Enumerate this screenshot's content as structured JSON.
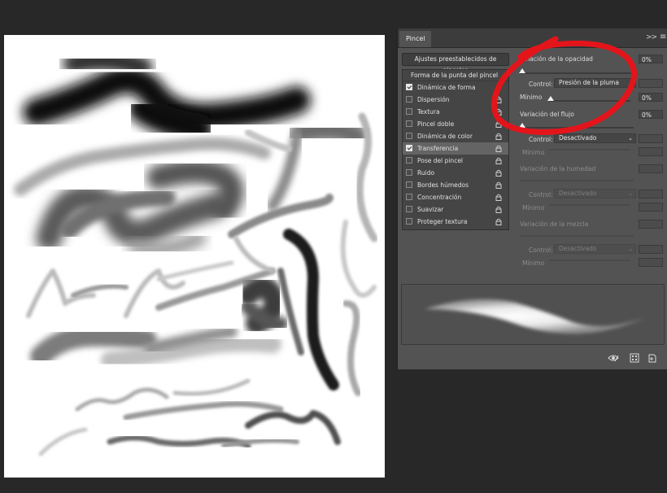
{
  "panel": {
    "tab_label": "Pincel",
    "collapse_label": ">>",
    "presets_button": "Ajustes preestablecidos de pinceles",
    "list_header": "Forma de la punta del pincel",
    "items": [
      {
        "label": "Dinámica de forma",
        "checked": true
      },
      {
        "label": "Dispersión",
        "checked": false
      },
      {
        "label": "Textura",
        "checked": false
      },
      {
        "label": "Pincel doble",
        "checked": false
      },
      {
        "label": "Dinámica de color",
        "checked": false
      },
      {
        "label": "Transferencia",
        "checked": true,
        "active": true
      },
      {
        "label": "Pose del pincel",
        "checked": false
      },
      {
        "label": "Ruido",
        "checked": false
      },
      {
        "label": "Bordes húmedos",
        "checked": false
      },
      {
        "label": "Concentración",
        "checked": false
      },
      {
        "label": "Suavizar",
        "checked": false
      },
      {
        "label": "Proteger textura",
        "checked": false
      }
    ]
  },
  "settings": {
    "opacity_label": "Variación de la opacidad",
    "opacity_value": "0%",
    "control_label": "Control:",
    "control_value": "Presión de la pluma",
    "min_label": "Mínimo",
    "min_value": "0%",
    "flow_label": "Variación del flujo",
    "flow_value": "0%",
    "flow_control_label": "Control:",
    "flow_control_value": "Desactivado",
    "flow_min_label": "Mínimo",
    "wet_label": "Variación de la humedad",
    "wet_control_label": "Control:",
    "wet_control_value": "Desactivado",
    "wet_min_label": "Mínimo",
    "mix_label": "Variación de la mezcla",
    "mix_control_label": "Control:",
    "mix_control_value": "Desactivado",
    "mix_min_label": "Mínimo"
  },
  "icons": {
    "collapse": "double-chevron-icon",
    "menu": "hamburger-icon",
    "lock": "lock-icon",
    "bottom": [
      "visibility-icon",
      "brush-library-icon",
      "new-brush-icon"
    ]
  },
  "colors": {
    "panel_bg": "#535353",
    "workspace_bg": "#282828",
    "annotation_red": "#e4141b"
  }
}
